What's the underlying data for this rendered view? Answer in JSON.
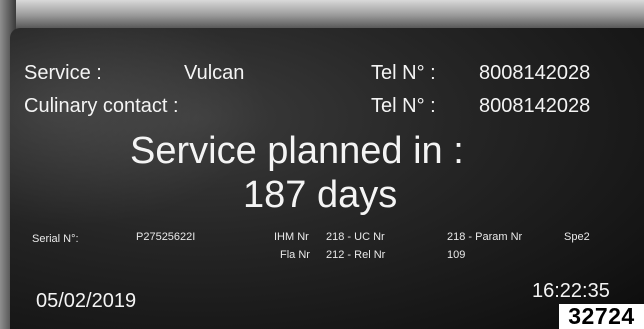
{
  "service": {
    "label": "Service :",
    "value": "Vulcan",
    "tel_label": "Tel N° :",
    "tel_value": "8008142028"
  },
  "culinary": {
    "label": "Culinary contact :",
    "tel_label": "Tel N° :",
    "tel_value": "8008142028"
  },
  "planned": {
    "line1": "Service planned in :",
    "line2": "187 days"
  },
  "details": {
    "serial_label": "Serial N°:",
    "serial_value": "P27525622I",
    "ihm_label": "IHM Nr",
    "ihm_value": "218 - UC Nr",
    "uc_value": "218 - Param Nr",
    "param_value": "Spe2",
    "fla_label": "Fla Nr",
    "fla_value": "212 - Rel Nr",
    "rel_value": "109"
  },
  "footer": {
    "date": "05/02/2019",
    "time": "16:22:35"
  },
  "tag": {
    "number": "32724"
  }
}
